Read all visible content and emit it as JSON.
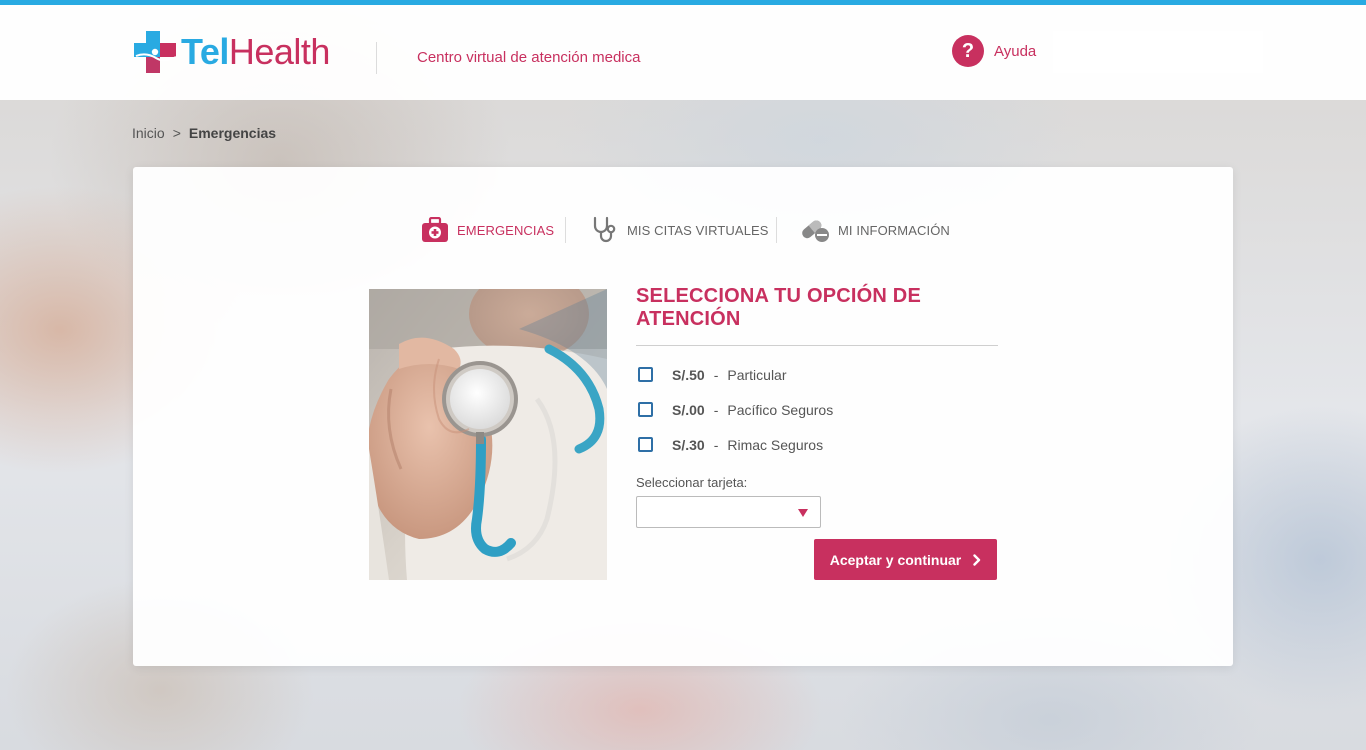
{
  "colors": {
    "brand_pink": "#c8305f",
    "brand_blue": "#29aae2",
    "checkbox_blue": "#2e6fa6"
  },
  "header": {
    "logo_tel": "Tel",
    "logo_health": "Health",
    "tagline": "Centro virtual de atención medica",
    "help_icon_text": "?",
    "help_label": "Ayuda"
  },
  "breadcrumb": {
    "home": "Inicio",
    "separator": ">",
    "current": "Emergencias"
  },
  "tabs": [
    {
      "label": "EMERGENCIAS",
      "icon": "first-aid-kit-icon",
      "active": true
    },
    {
      "label": "MIS CITAS VIRTUALES",
      "icon": "stethoscope-icon",
      "active": false
    },
    {
      "label": "MI INFORMACIÓN",
      "icon": "pills-icon",
      "active": false
    }
  ],
  "form": {
    "title": "SELECCIONA TU OPCIÓN DE ATENCIÓN",
    "options": [
      {
        "price": "S/.50",
        "separator": "-",
        "name": "Particular",
        "checked": false
      },
      {
        "price": "S/.00",
        "separator": "-",
        "name": "Pacífico Seguros",
        "checked": false
      },
      {
        "price": "S/.30",
        "separator": "-",
        "name": "Rimac Seguros",
        "checked": false
      }
    ],
    "select_label": "Seleccionar tarjeta:",
    "select_value": "",
    "submit_label": "Aceptar y continuar"
  }
}
